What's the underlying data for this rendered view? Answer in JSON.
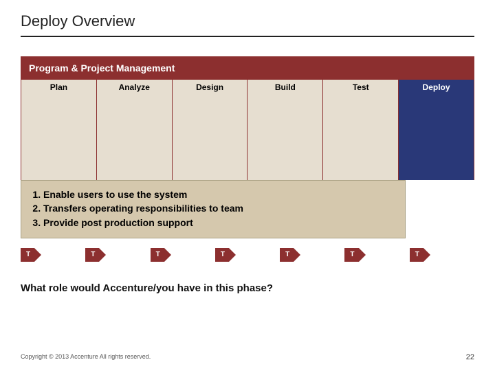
{
  "title": "Deploy Overview",
  "mgmt_bar": "Program & Project Management",
  "phases": [
    {
      "label": "Plan",
      "active": false
    },
    {
      "label": "Analyze",
      "active": false
    },
    {
      "label": "Design",
      "active": false
    },
    {
      "label": "Build",
      "active": false
    },
    {
      "label": "Test",
      "active": false
    },
    {
      "label": "Deploy",
      "active": true
    }
  ],
  "bullets": [
    "Enable users to use the system",
    "Transfers operating responsibilities to team",
    "Provide post production support"
  ],
  "t_markers": [
    "T",
    "T",
    "T",
    "T",
    "T",
    "T",
    "T"
  ],
  "question": "What role would Accenture/you have in this phase?",
  "copyright": "Copyright © 2013 Accenture  All rights reserved.",
  "page_number": "22"
}
